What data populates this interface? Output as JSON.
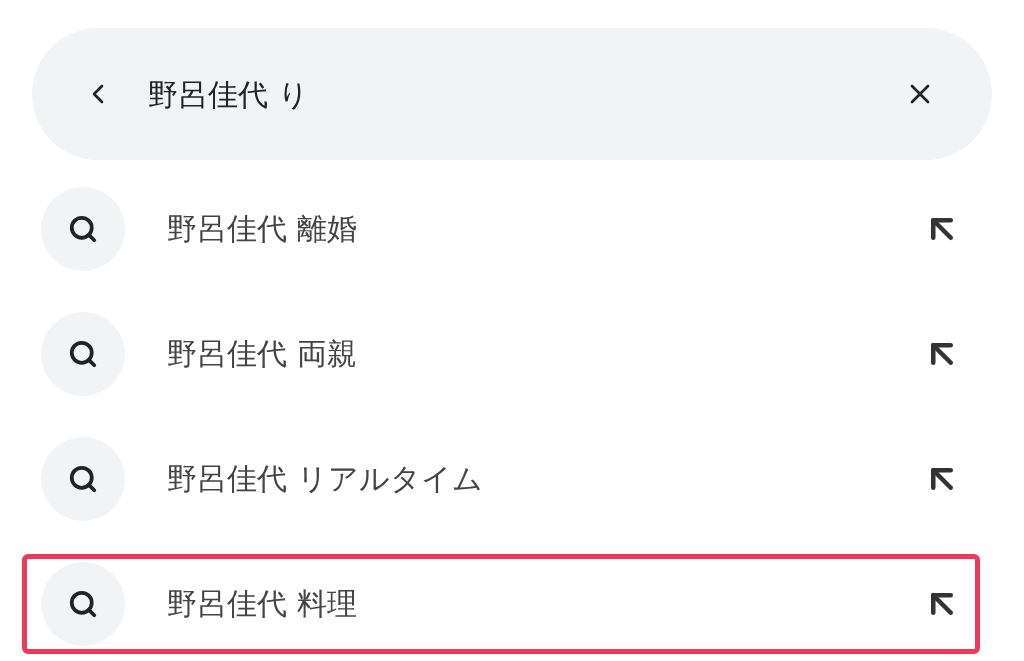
{
  "search": {
    "value": "野呂佳代 り"
  },
  "suggestions": [
    {
      "text": "野呂佳代 離婚",
      "highlighted": false
    },
    {
      "text": "野呂佳代 両親",
      "highlighted": false
    },
    {
      "text": "野呂佳代 リアルタイム",
      "highlighted": false
    },
    {
      "text": "野呂佳代 料理",
      "highlighted": true
    }
  ]
}
